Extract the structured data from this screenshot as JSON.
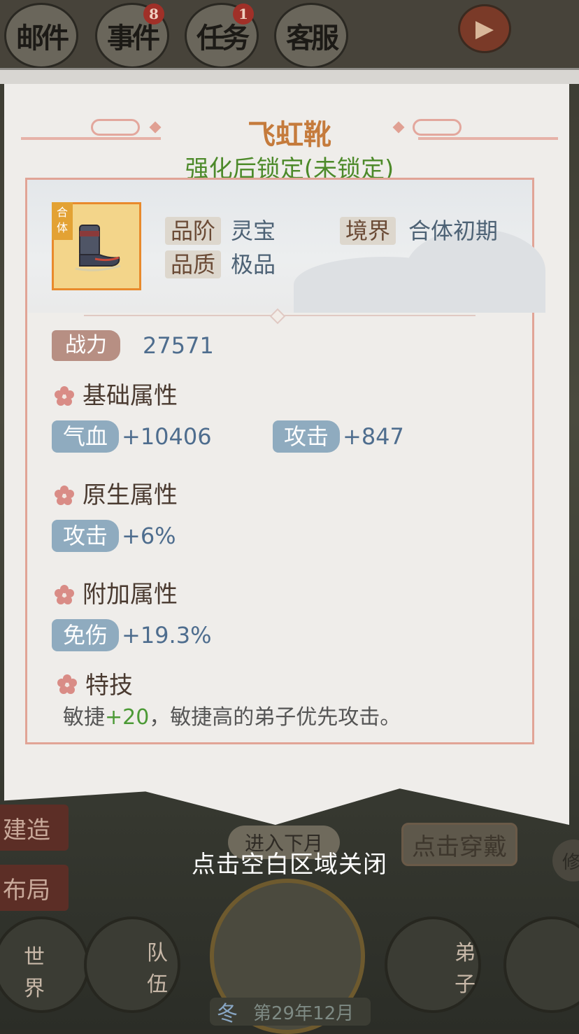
{
  "background": {
    "top_buttons": [
      {
        "label": "邮件",
        "badge": ""
      },
      {
        "label": "事件",
        "badge": "8"
      },
      {
        "label": "任务",
        "badge": "1"
      },
      {
        "label": "客服",
        "badge": ""
      }
    ],
    "side_buttons": [
      "建造",
      "布局"
    ],
    "next_month_label": "进入下月",
    "wear_button_label": "点击穿戴",
    "xiu_label": "修",
    "dock": {
      "world_label": "世界",
      "team_label": "队伍",
      "disciple_label": "弟子"
    },
    "date": {
      "season": "冬",
      "text": "第29年12月"
    }
  },
  "panel": {
    "title": "飞虹靴",
    "subtitle": "强化后锁定(未锁定)",
    "item_tag": "合体",
    "grade_label": "品阶",
    "grade_value": "灵宝",
    "realm_label": "境界",
    "realm_value": "合体初期",
    "quality_label": "品质",
    "quality_value": "极品",
    "power_label": "战力",
    "power_value": "27571",
    "sections": {
      "base": {
        "title": "基础属性",
        "stats": [
          {
            "name": "气血",
            "value": "+10406"
          },
          {
            "name": "攻击",
            "value": "+847"
          }
        ]
      },
      "native": {
        "title": "原生属性",
        "stats": [
          {
            "name": "攻击",
            "value": "+6%"
          }
        ]
      },
      "extra": {
        "title": "附加属性",
        "stats": [
          {
            "name": "免伤",
            "value": "+19.3%"
          }
        ]
      },
      "skill": {
        "title": "特技",
        "prefix": "敏捷",
        "plus": "+20",
        "suffix": "，敏捷高的弟子优先攻击。"
      }
    }
  },
  "close_hint": "点击空白区域关闭",
  "colors": {
    "title": "#c57b3c",
    "subtitle": "#4d8a2a",
    "stat_tag": "#8fabbf",
    "power_tag": "#b78f83",
    "border": "#e1a496"
  },
  "icons": [
    "play-icon",
    "boots-icon",
    "flower-icon"
  ]
}
